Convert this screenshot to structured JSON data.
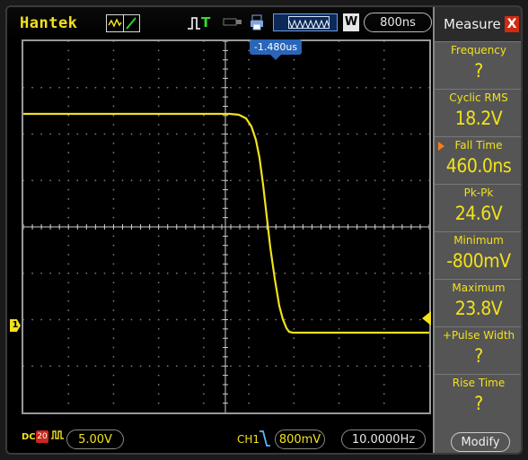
{
  "brand": "Hantek",
  "top": {
    "timebase": "800ns",
    "w_badge": "W",
    "trigger_position": "-1.480us",
    "icons": [
      "acquire-mode-icon",
      "trigger-icon",
      "usb-icon",
      "print-icon",
      "memory-bar-icon"
    ]
  },
  "channel": {
    "marker": "1",
    "coupling": "DC",
    "bw_limit": "20",
    "volts_div": "5.00V",
    "label": "CH1",
    "trigger_level": "800mV",
    "frequency": "10.0000Hz"
  },
  "panel": {
    "title": "Measure",
    "close": "X",
    "modify": "Modify",
    "items": [
      {
        "label": "Frequency",
        "value": "?",
        "selected": false
      },
      {
        "label": "Cyclic RMS",
        "value": "18.2V",
        "selected": false
      },
      {
        "label": "Fall Time",
        "value": "460.0ns",
        "selected": true
      },
      {
        "label": "Pk-Pk",
        "value": "24.6V",
        "selected": false
      },
      {
        "label": "Minimum",
        "value": "-800mV",
        "selected": false
      },
      {
        "label": "Maximum",
        "value": "23.8V",
        "selected": false
      },
      {
        "label": "+Pulse Width",
        "value": "?",
        "selected": false
      },
      {
        "label": "Rise Time",
        "value": "?",
        "selected": false
      }
    ]
  },
  "colors": {
    "trace": "#f2e11c",
    "accent_blue": "#2a65b8",
    "close_red": "#d12a10",
    "panel_bg": "#555555"
  }
}
